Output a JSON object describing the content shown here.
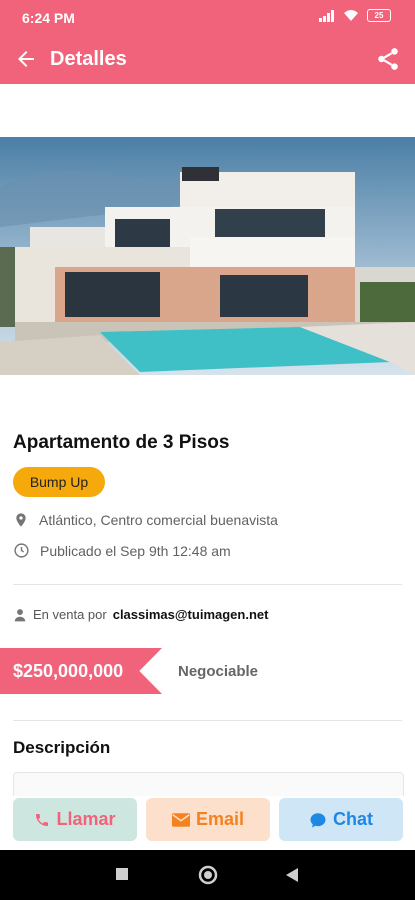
{
  "status": {
    "time": "6:24 PM",
    "battery": "25"
  },
  "appbar": {
    "title": "Detalles"
  },
  "listing": {
    "title": "Apartamento de 3 Pisos",
    "badge": "Bump Up",
    "location": "Atlántico, Centro comercial buenavista",
    "published": "Publicado el Sep 9th 12:48 am",
    "seller_prefix": "En venta por",
    "seller_email": "classimas@tuimagen.net",
    "price": "$250,000,000",
    "negotiable": "Negociable",
    "description_title": "Descripción"
  },
  "actions": {
    "call": "Llamar",
    "email": "Email",
    "chat": "Chat"
  },
  "colors": {
    "primary": "#f0637a",
    "badge": "#f5a90a",
    "email": "#f58220",
    "chat": "#1e88e5"
  }
}
